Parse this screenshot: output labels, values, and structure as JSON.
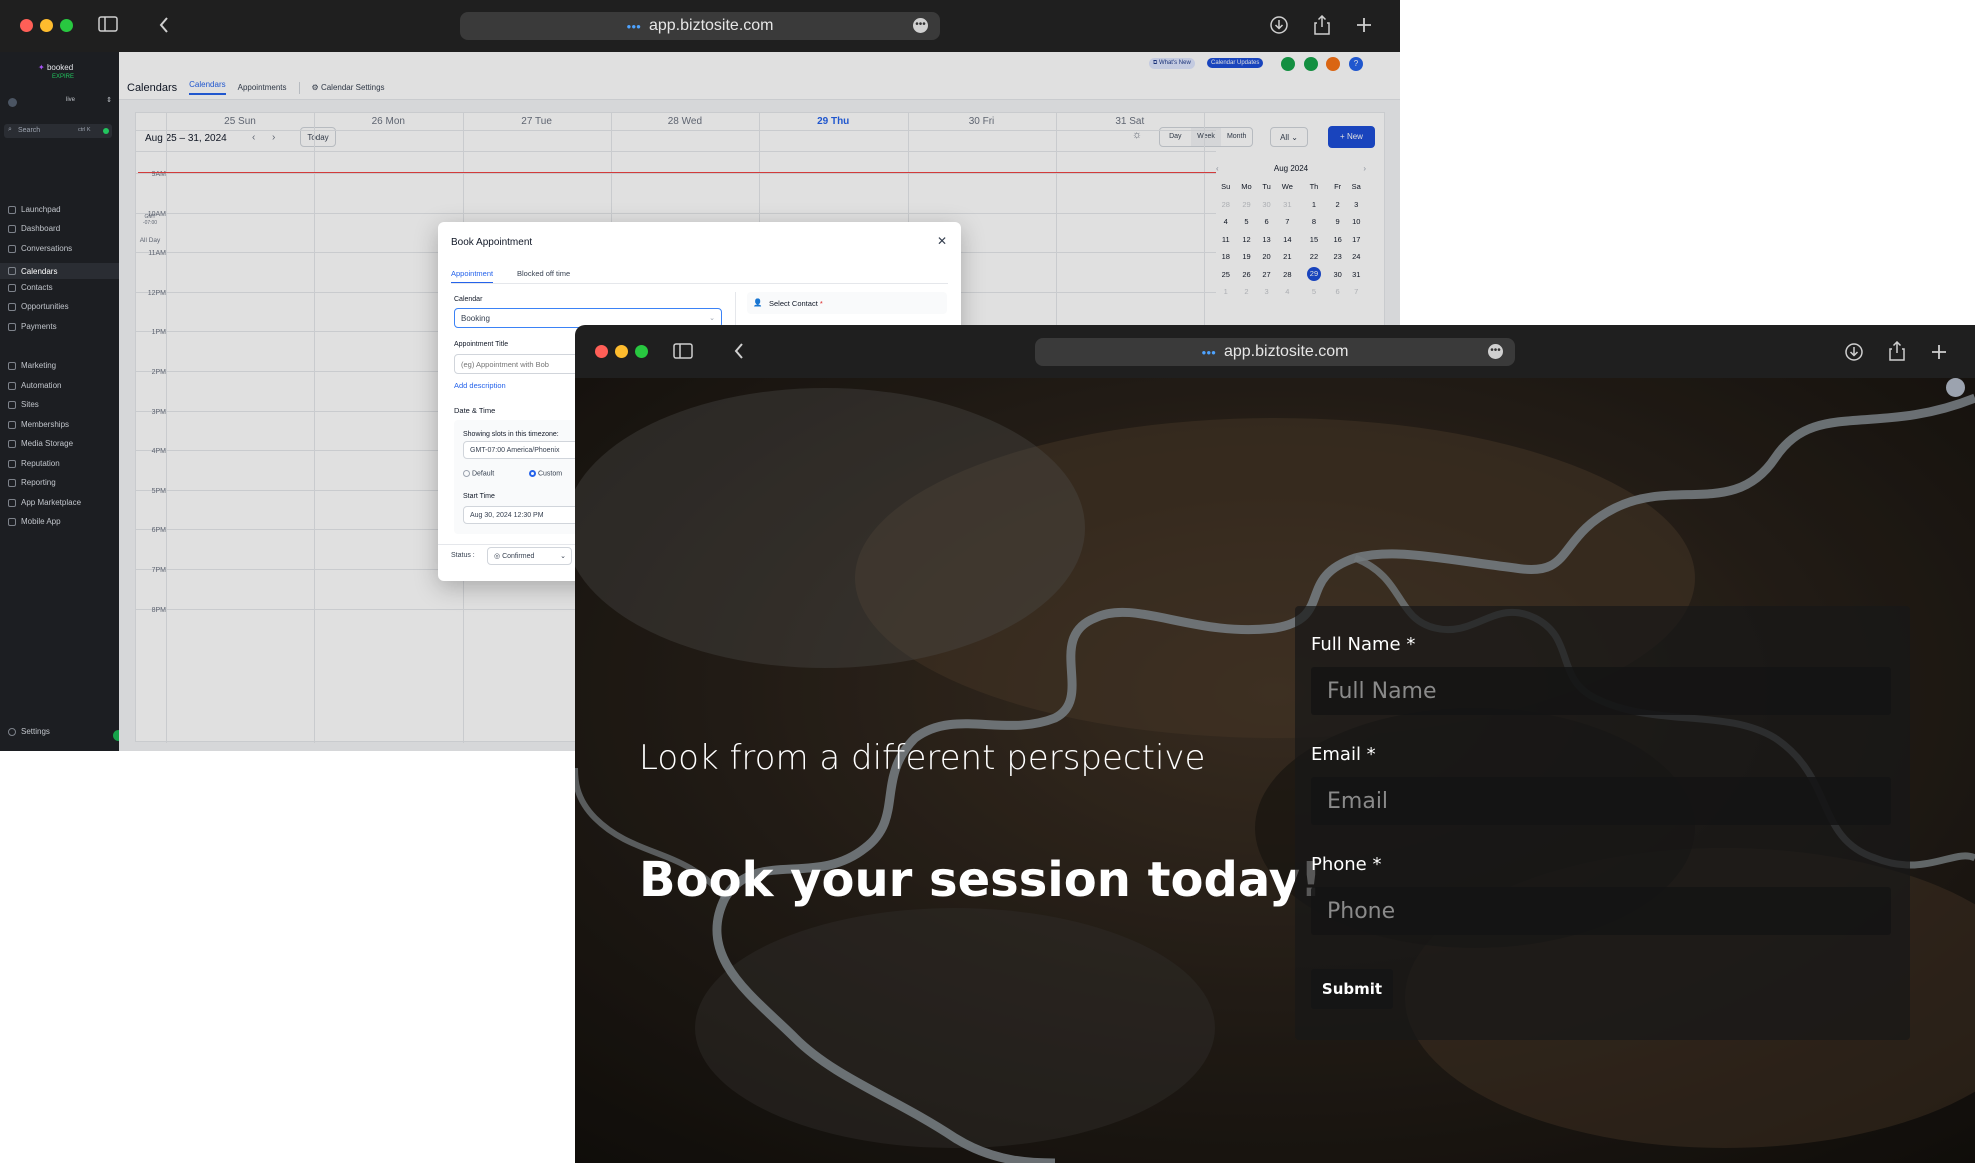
{
  "back_window": {
    "url": "app.biztosite.com",
    "brand_line1": "booked",
    "brand_line2": "EXPIRE",
    "account": "live",
    "search_placeholder": "Search",
    "search_shortcut": "ctrl K",
    "nav": [
      "Launchpad",
      "Dashboard",
      "Conversations",
      "Calendars",
      "Contacts",
      "Opportunities",
      "Payments",
      "Marketing",
      "Automation",
      "Sites",
      "Memberships",
      "Media Storage",
      "Reputation",
      "Reporting",
      "App Marketplace",
      "Mobile App"
    ],
    "active_nav": "Calendars",
    "settings_label": "Settings",
    "page_title": "Calendars",
    "tabs": [
      "Calendars",
      "Appointments",
      "Calendar Settings"
    ],
    "whats_new": "What's New",
    "calendar_updates": "Calendar Updates",
    "date_range": "Aug 25 – 31, 2024",
    "today_btn": "Today",
    "views": [
      "Day",
      "Week",
      "Month"
    ],
    "filter_all": "All",
    "new_btn": "+ New",
    "gmt_line1": "GMT",
    "gmt_line2": "-07:00",
    "all_day": "All Day",
    "days": [
      "25 Sun",
      "26 Mon",
      "27 Tue",
      "28 Wed",
      "29 Thu",
      "30 Fri",
      "31 Sat"
    ],
    "hours": [
      "9AM",
      "10AM",
      "11AM",
      "12PM",
      "1PM",
      "2PM",
      "3PM",
      "4PM",
      "5PM",
      "6PM",
      "7PM",
      "8PM"
    ],
    "mini_cal": {
      "title": "Aug 2024",
      "weekdays": [
        "Su",
        "Mo",
        "Tu",
        "We",
        "Th",
        "Fr",
        "Sa"
      ],
      "weeks": [
        [
          "28",
          "29",
          "30",
          "31",
          "1",
          "2",
          "3"
        ],
        [
          "4",
          "5",
          "6",
          "7",
          "8",
          "9",
          "10"
        ],
        [
          "11",
          "12",
          "13",
          "14",
          "15",
          "16",
          "17"
        ],
        [
          "18",
          "19",
          "20",
          "21",
          "22",
          "23",
          "24"
        ],
        [
          "25",
          "26",
          "27",
          "28",
          "29",
          "30",
          "31"
        ],
        [
          "1",
          "2",
          "3",
          "4",
          "5",
          "6",
          "7"
        ]
      ],
      "selected": "29"
    },
    "modal": {
      "title": "Book Appointment",
      "tab_appointment": "Appointment",
      "tab_blocked": "Blocked off time",
      "calendar_label": "Calendar",
      "calendar_value": "Booking",
      "appt_title_label": "Appointment Title",
      "appt_title_placeholder": "(eg) Appointment with Bob",
      "add_description": "Add description",
      "date_time_label": "Date & Time",
      "slots_text": "Showing slots in this timezone:",
      "timezone_value": "GMT-07:00 America/Phoenix",
      "radio_default": "Default",
      "radio_custom": "Custom",
      "start_time_label": "Start Time",
      "start_time_value": "Aug 30, 2024 12:30 PM",
      "select_contact_label": "Select Contact",
      "status_label": "Status :",
      "status_value": "Confirmed"
    }
  },
  "front_window": {
    "url": "app.biztosite.com",
    "subheading": "Look from a different perspective",
    "heading": "Book your session today!",
    "form": {
      "full_name_label": "Full Name *",
      "full_name_placeholder": "Full Name",
      "email_label": "Email *",
      "email_placeholder": "Email",
      "phone_label": "Phone *",
      "phone_placeholder": "Phone",
      "submit_label": "Submit"
    }
  },
  "colors": {
    "accent_blue": "#2563eb",
    "sidebar_bg": "#1c1e22",
    "chrome_bg": "#1f1f1f",
    "now_line": "#ef4444"
  }
}
